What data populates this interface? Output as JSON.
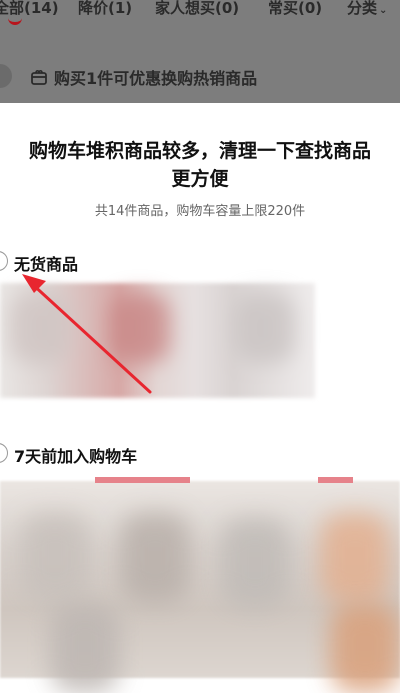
{
  "tabs": [
    {
      "label": "全部(14)"
    },
    {
      "label": "降价(1)"
    },
    {
      "label": "家人想买(0)"
    },
    {
      "label": "常买(0)"
    },
    {
      "label": "分类"
    }
  ],
  "promo": {
    "text": "购买1件可优惠换购热销商品"
  },
  "sheet": {
    "title": "购物车堆积商品较多，清理一下查找商品更方便",
    "subtitle": "共14件商品，购物车容量上限220件",
    "groups": [
      {
        "label": "无货商品"
      },
      {
        "label": "7天前加入购物车"
      }
    ]
  },
  "colors": {
    "accent": "#b8141c",
    "arrow": "#e8262f"
  },
  "icons": {
    "promo": "gift-icon",
    "category": "chevron-down-icon"
  }
}
